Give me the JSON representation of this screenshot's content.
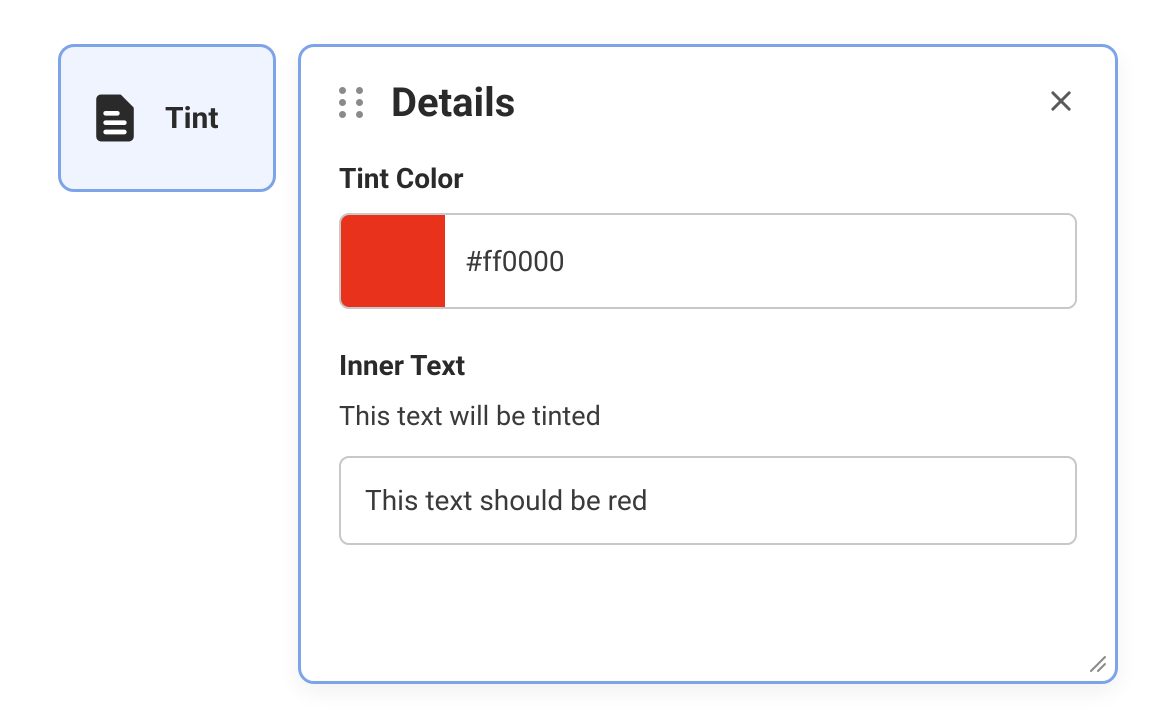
{
  "node": {
    "label": "Tint"
  },
  "panel": {
    "title": "Details",
    "fields": {
      "tintColor": {
        "label": "Tint Color",
        "value": "#ff0000",
        "swatch": "#e8321c"
      },
      "innerText": {
        "label": "Inner Text",
        "description": "This text will be tinted",
        "value": "This text should be red"
      }
    }
  }
}
